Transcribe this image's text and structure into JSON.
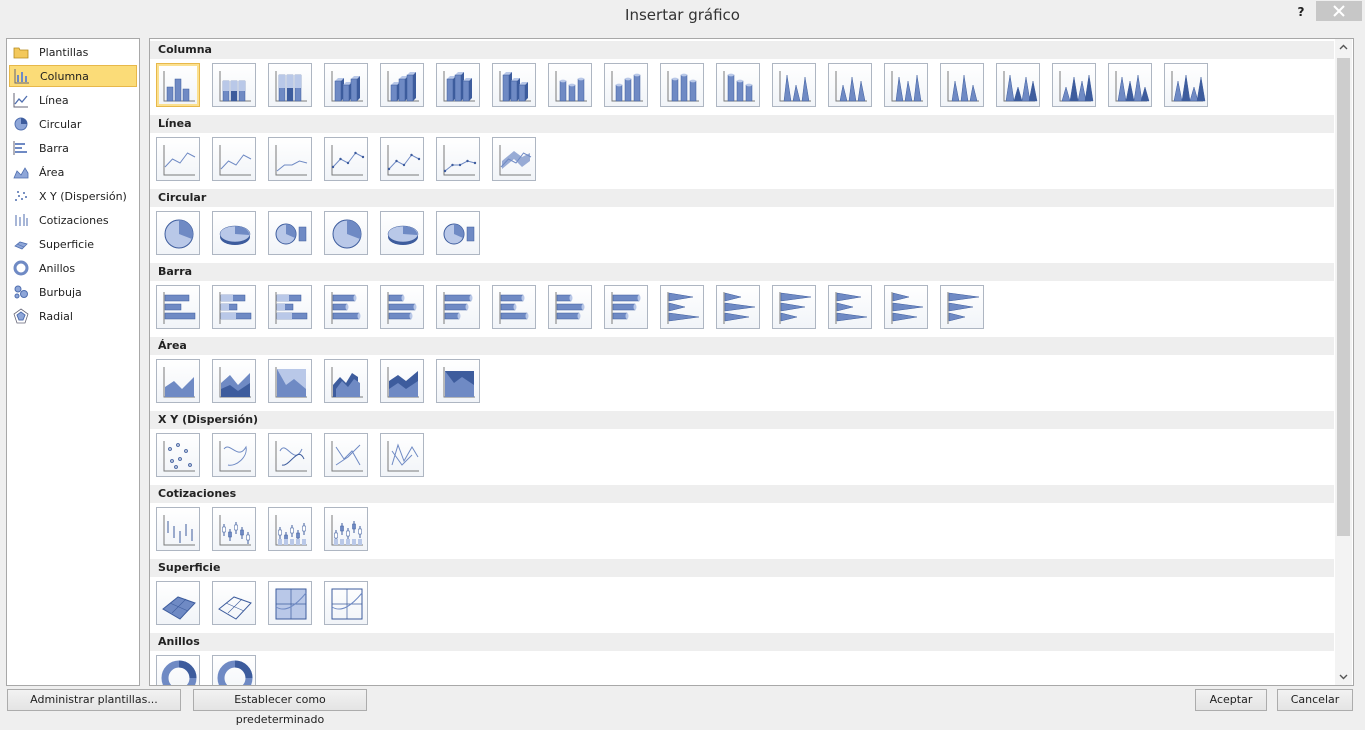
{
  "dialog": {
    "title": "Insertar gráfico",
    "help_label": "?"
  },
  "categories": [
    {
      "label": "Plantillas",
      "icon": "folder-icon"
    },
    {
      "label": "Columna",
      "icon": "column-chart-icon",
      "selected": true
    },
    {
      "label": "Línea",
      "icon": "line-chart-icon"
    },
    {
      "label": "Circular",
      "icon": "pie-chart-icon"
    },
    {
      "label": "Barra",
      "icon": "bar-chart-icon"
    },
    {
      "label": "Área",
      "icon": "area-chart-icon"
    },
    {
      "label": "X Y (Dispersión)",
      "icon": "scatter-chart-icon"
    },
    {
      "label": "Cotizaciones",
      "icon": "stock-chart-icon"
    },
    {
      "label": "Superficie",
      "icon": "surface-chart-icon"
    },
    {
      "label": "Anillos",
      "icon": "doughnut-chart-icon"
    },
    {
      "label": "Burbuja",
      "icon": "bubble-chart-icon"
    },
    {
      "label": "Radial",
      "icon": "radar-chart-icon"
    }
  ],
  "sections": [
    {
      "title": "Columna",
      "type": "column",
      "count": 19
    },
    {
      "title": "Línea",
      "type": "line",
      "count": 7
    },
    {
      "title": "Circular",
      "type": "pie",
      "count": 6
    },
    {
      "title": "Barra",
      "type": "bar",
      "count": 15
    },
    {
      "title": "Área",
      "type": "area",
      "count": 6
    },
    {
      "title": "X Y (Dispersión)",
      "type": "scatter",
      "count": 5
    },
    {
      "title": "Cotizaciones",
      "type": "stock",
      "count": 4
    },
    {
      "title": "Superficie",
      "type": "surface",
      "count": 4
    },
    {
      "title": "Anillos",
      "type": "doughnut",
      "count": 2
    }
  ],
  "buttons": {
    "manage_templates": "Administrar plantillas...",
    "set_default": "Establecer como predeterminado",
    "ok": "Aceptar",
    "cancel": "Cancelar"
  },
  "colors": {
    "selection_fill": "#fbdc78",
    "selection_border": "#e7b84a",
    "chart_accent": "#6f8ac4"
  }
}
